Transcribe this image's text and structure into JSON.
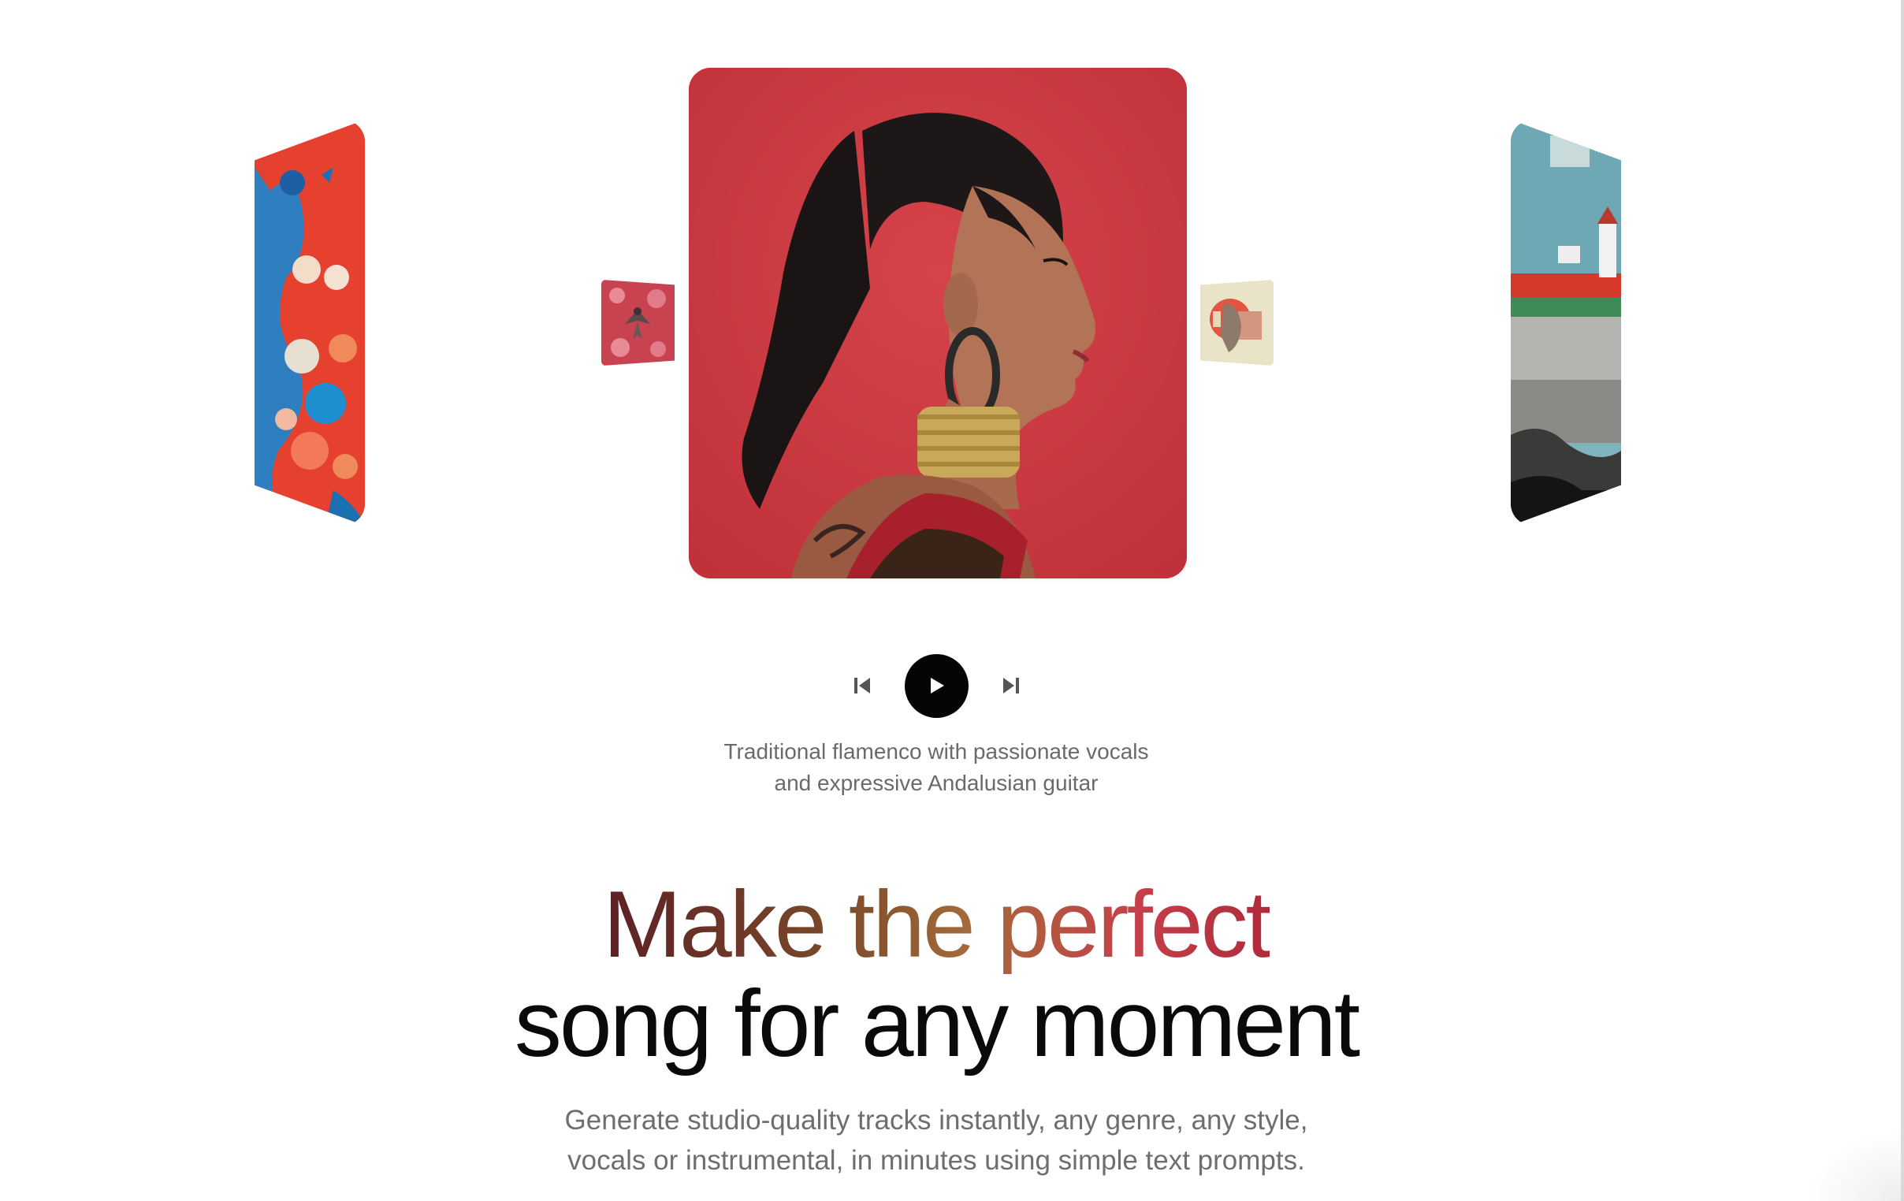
{
  "player": {
    "prev_label": "Previous track",
    "play_label": "Play",
    "next_label": "Next track",
    "caption_line1": "Traditional flamenco with passionate vocals",
    "caption_line2": "and expressive Andalusian guitar"
  },
  "hero": {
    "headline_line1": "Make the perfect",
    "headline_line2": "song for any moment",
    "subtext_line1": "Generate studio-quality tracks instantly, any genre, any style,",
    "subtext_line2": "vocals or instrumental, in minutes using simple text prompts."
  },
  "colors": {
    "accent_dark": "#5c2024",
    "accent_gold": "#a56a3a",
    "accent_red": "#c4404a",
    "play_button": "#050505",
    "caption_gray": "#6a6a6a"
  },
  "icons": {
    "prev": "skip-back-icon",
    "play": "play-icon",
    "next": "skip-forward-icon"
  }
}
